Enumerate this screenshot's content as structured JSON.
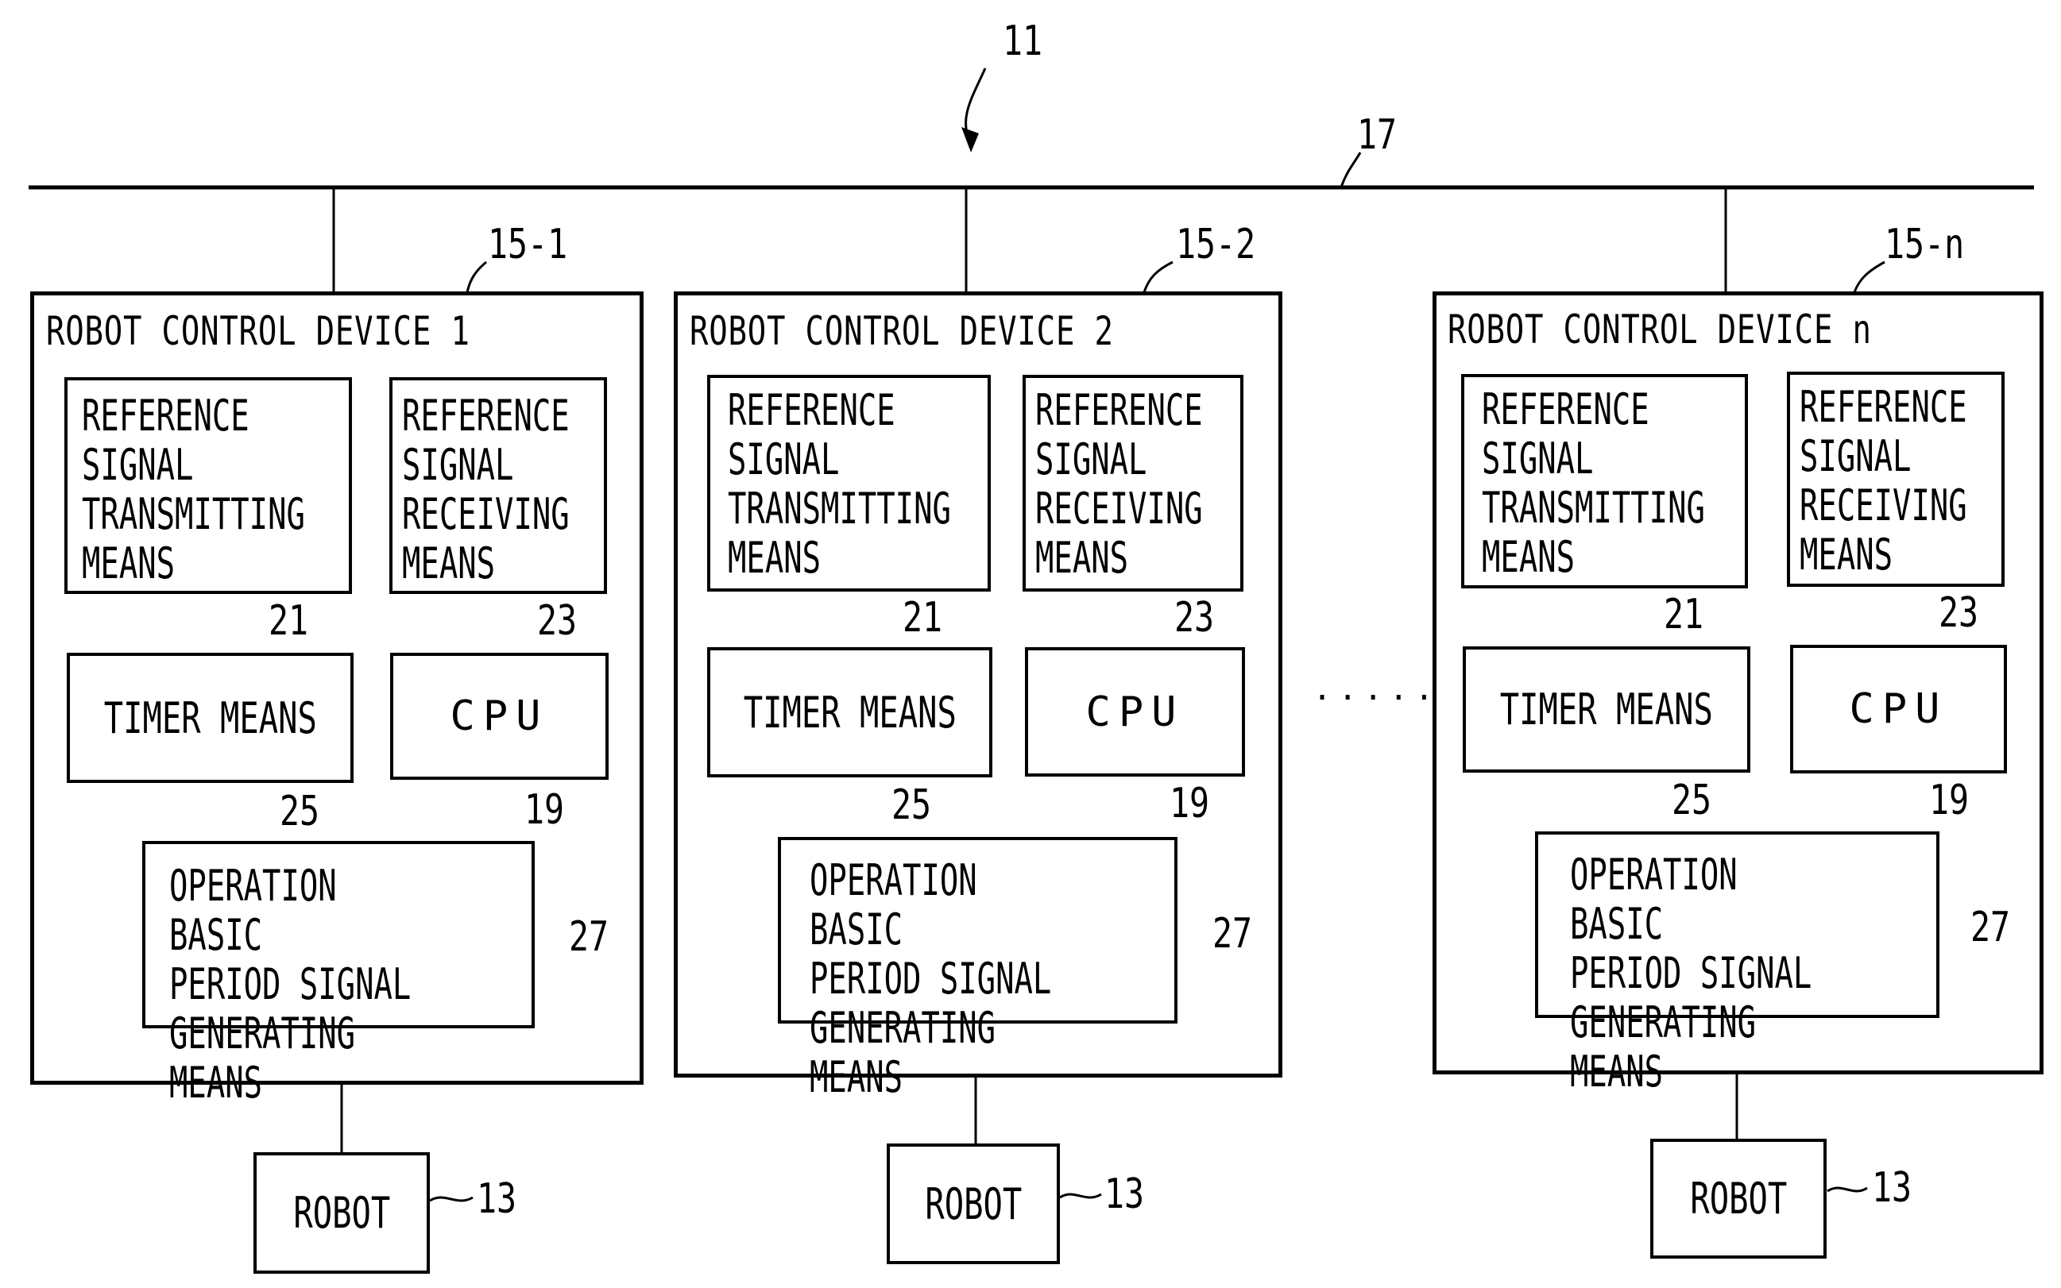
{
  "figure": {
    "system_ref": "11",
    "bus_ref": "17",
    "ellipsis": "·····",
    "devices": [
      {
        "ref": "15-1",
        "title": "ROBOT CONTROL DEVICE 1",
        "transmit": {
          "label": "REFERENCE\nSIGNAL\nTRANSMITTING\nMEANS",
          "ref": "21"
        },
        "receive": {
          "label": "REFERENCE\nSIGNAL\nRECEIVING\nMEANS",
          "ref": "23"
        },
        "timer": {
          "label": "TIMER MEANS",
          "ref": "25"
        },
        "cpu": {
          "label": "CPU",
          "ref": "19"
        },
        "operation": {
          "label": "OPERATION BASIC\nPERIOD SIGNAL\nGENERATING MEANS",
          "ref": "27"
        },
        "robot": {
          "label": "ROBOT",
          "ref": "13"
        }
      },
      {
        "ref": "15-2",
        "title": "ROBOT CONTROL DEVICE 2",
        "transmit": {
          "label": "REFERENCE\nSIGNAL\nTRANSMITTING\nMEANS",
          "ref": "21"
        },
        "receive": {
          "label": "REFERENCE\nSIGNAL\nRECEIVING\nMEANS",
          "ref": "23"
        },
        "timer": {
          "label": "TIMER MEANS",
          "ref": "25"
        },
        "cpu": {
          "label": "CPU",
          "ref": "19"
        },
        "operation": {
          "label": "OPERATION BASIC\nPERIOD SIGNAL\nGENERATING MEANS",
          "ref": "27"
        },
        "robot": {
          "label": "ROBOT",
          "ref": "13"
        }
      },
      {
        "ref": "15-n",
        "title": "ROBOT CONTROL DEVICE n",
        "transmit": {
          "label": "REFERENCE\nSIGNAL\nTRANSMITTING\nMEANS",
          "ref": "21"
        },
        "receive": {
          "label": "REFERENCE\nSIGNAL\nRECEIVING\nMEANS",
          "ref": "23"
        },
        "timer": {
          "label": "TIMER MEANS",
          "ref": "25"
        },
        "cpu": {
          "label": "CPU",
          "ref": "19"
        },
        "operation": {
          "label": "OPERATION BASIC\nPERIOD SIGNAL\nGENERATING MEANS",
          "ref": "27"
        },
        "robot": {
          "label": "ROBOT",
          "ref": "13"
        }
      }
    ]
  }
}
